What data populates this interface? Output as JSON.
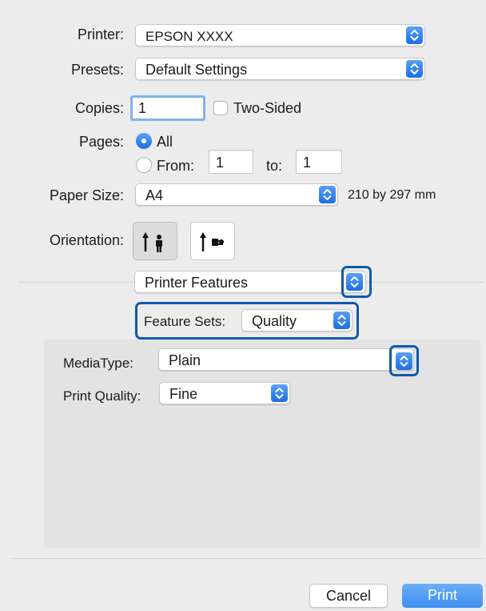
{
  "printer": {
    "label": "Printer:",
    "value": "EPSON XXXX"
  },
  "presets": {
    "label": "Presets:",
    "value": "Default Settings"
  },
  "copies": {
    "label": "Copies:",
    "value": "1",
    "two_sided_label": "Two-Sided",
    "two_sided_checked": false
  },
  "pages": {
    "label": "Pages:",
    "all_label": "All",
    "from_label": "From:",
    "from_value": "1",
    "to_label": "to:",
    "to_value": "1",
    "selected": "All"
  },
  "paper_size": {
    "label": "Paper Size:",
    "value": "A4",
    "dimensions": "210 by 297 mm"
  },
  "orientation": {
    "label": "Orientation:",
    "options": [
      "portrait",
      "landscape"
    ],
    "selected": "portrait"
  },
  "section_popup": {
    "value": "Printer Features"
  },
  "feature_sets": {
    "label": "Feature Sets:",
    "value": "Quality"
  },
  "media_type": {
    "label": "MediaType:",
    "value": "Plain"
  },
  "print_quality": {
    "label": "Print Quality:",
    "value": "Fine"
  },
  "buttons": {
    "cancel": "Cancel",
    "print": "Print"
  },
  "colors": {
    "accent": "#1c6fe3",
    "highlight": "#0f5aa8",
    "print_button": "#4a97f2"
  }
}
